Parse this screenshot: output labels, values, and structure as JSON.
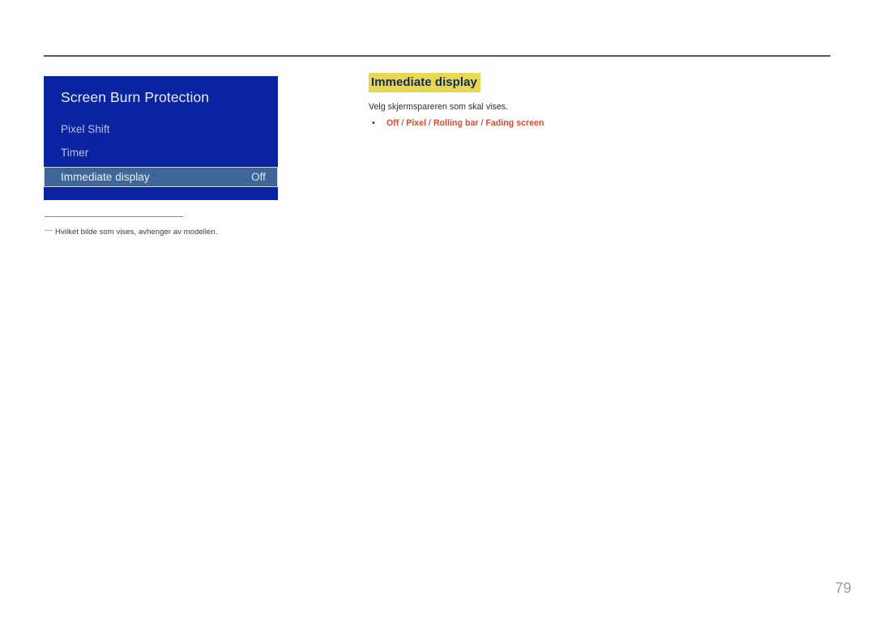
{
  "page": {
    "number": "79",
    "background": "#ffffff",
    "rule_color": "#595959"
  },
  "osd": {
    "title": "Screen Burn Protection",
    "panel_color": "#0a23a0",
    "selected_row_color": "#3d6699",
    "items": [
      {
        "label": "Pixel Shift",
        "value": "",
        "selected": false
      },
      {
        "label": "Timer",
        "value": "",
        "selected": false
      },
      {
        "label": "Immediate display",
        "value": "Off",
        "selected": true
      }
    ]
  },
  "footnote": {
    "marker": "―",
    "text": "Hvilket bilde som vises, avhenger av modellen."
  },
  "section": {
    "heading": "Immediate display",
    "heading_highlight": "#e8d655",
    "heading_color": "#132c63",
    "description": "Velg skjermspareren som skal vises.",
    "options": [
      {
        "bullet": "•",
        "parts": [
          {
            "text": "Off",
            "type": "option"
          },
          {
            "text": " / ",
            "type": "separator"
          },
          {
            "text": "Pixel",
            "type": "option"
          },
          {
            "text": " / ",
            "type": "separator"
          },
          {
            "text": "Rolling bar",
            "type": "option"
          },
          {
            "text": " / ",
            "type": "separator"
          },
          {
            "text": "Fading screen",
            "type": "option"
          }
        ]
      }
    ],
    "option_color": "#e8482b"
  }
}
